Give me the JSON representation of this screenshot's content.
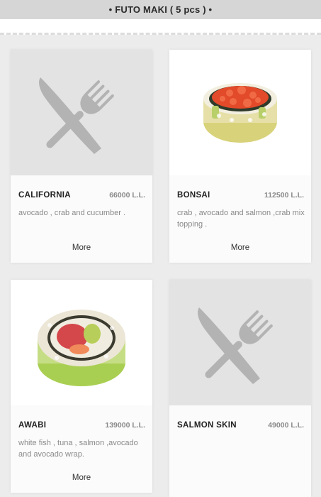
{
  "section": {
    "title": "• FUTO MAKI ( 5 pcs ) •"
  },
  "items": [
    {
      "name": "CALIFORNIA",
      "price": "66000 L.L.",
      "description": "avocado , crab and cucumber .",
      "more": "More",
      "image": "utensils-placeholder-icon"
    },
    {
      "name": "BONSAI",
      "price": "112500 L.L.",
      "description": "crab , avocado and salmon ,crab mix topping .",
      "more": "More",
      "image": "bonsai-roll-photo"
    },
    {
      "name": "AWABI",
      "price": "139000 L.L.",
      "description": "white fish , tuna , salmon ,avocado and avocado wrap.",
      "more": "More",
      "image": "awabi-roll-photo"
    },
    {
      "name": "SALMON SKIN",
      "price": "49000 L.L.",
      "description": "",
      "more": "",
      "image": "utensils-placeholder-icon"
    }
  ],
  "colors": {
    "header_bg": "#d6d6d6",
    "placeholder_bg": "#e3e3e3",
    "price_text": "#8a8a8a"
  }
}
